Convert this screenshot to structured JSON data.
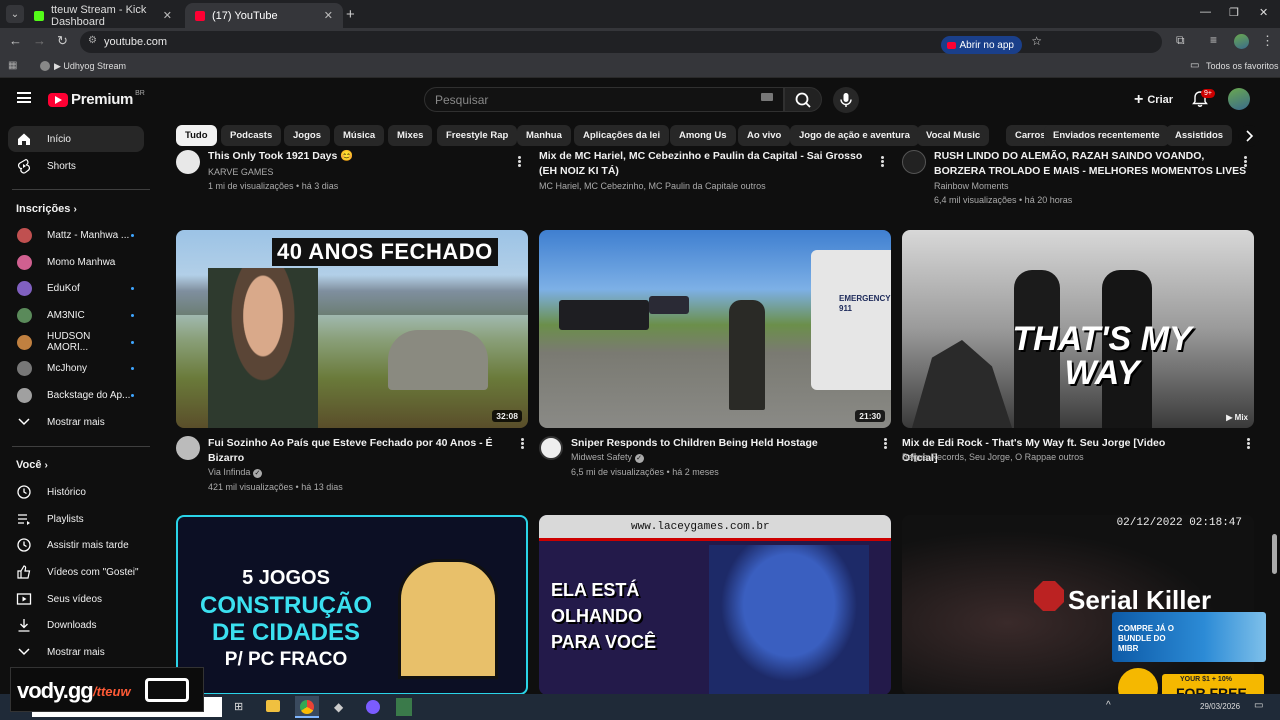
{
  "browser": {
    "tabs": [
      {
        "label": "tteuw Stream - Kick Dashboard",
        "favicon_color": "#53fc18"
      },
      {
        "label": "(17) YouTube",
        "favicon_color": "#ff0033"
      }
    ],
    "url": "youtube.com",
    "open_app_label": "Abrir no app",
    "bookmark": "Udhyog Stream",
    "all_favorites": "Todos os favoritos"
  },
  "header": {
    "logo_text": "Premium",
    "region": "BR",
    "search_placeholder": "Pesquisar",
    "create_label": "Criar",
    "notifications_badge": "9+"
  },
  "sidebar": {
    "main": [
      {
        "label": "Início",
        "icon": "home-icon",
        "active": true
      },
      {
        "label": "Shorts",
        "icon": "shorts-icon",
        "active": false
      }
    ],
    "subscriptions_title": "Inscrições",
    "subscriptions": [
      {
        "label": "Mattz - Manhwa ...",
        "color": "#c05050"
      },
      {
        "label": "Momo Manhwa",
        "color": "#d06090"
      },
      {
        "label": "EduKof",
        "color": "#8060c0"
      },
      {
        "label": "AM3NIC",
        "color": "#5a8a5a"
      },
      {
        "label": "HUDSON AMORI...",
        "color": "#c08040"
      },
      {
        "label": "McJhony",
        "color": "#777777"
      },
      {
        "label": "Backstage do Ap...",
        "color": "#a0a0a0"
      }
    ],
    "show_more": "Mostrar mais",
    "you_title": "Você",
    "you_items": [
      {
        "label": "Histórico",
        "icon": "history-icon"
      },
      {
        "label": "Playlists",
        "icon": "playlists-icon"
      },
      {
        "label": "Assistir mais tarde",
        "icon": "watch-later-icon"
      },
      {
        "label": "Vídeos com \"Gostei\"",
        "icon": "thumbs-up-icon"
      },
      {
        "label": "Seus vídeos",
        "icon": "your-videos-icon"
      },
      {
        "label": "Downloads",
        "icon": "download-icon"
      }
    ],
    "show_more_2": "Mostrar mais"
  },
  "chips": [
    "Tudo",
    "Podcasts",
    "Jogos",
    "Música",
    "Mixes",
    "Freestyle Rap",
    "Manhua",
    "Aplicações da lei",
    "Among Us",
    "Ao vivo",
    "Jogo de ação e aventura",
    "Vocal Music",
    "Carros",
    "Enviados recentemente",
    "Assistidos"
  ],
  "top_row": [
    {
      "title": "This Only Took 1921 Days 😊",
      "channel": "KARVE GAMES",
      "stats": "1 mi de visualizações • há 3 dias"
    },
    {
      "title": "Mix de MC Hariel, MC Cebezinho e Paulin da Capital - Sai Grosso (EH NOIZ KI TÁ)",
      "channel": "MC Hariel, MC Cebezinho, MC Paulin da Capitale outros",
      "stats": ""
    },
    {
      "title": "RUSH LINDO DO ALEMÃO, RAZAH SAINDO VOANDO, BORZERA TROLADO E MAIS - MELHORES MOMENTOS LIVES R6",
      "channel": "Rainbow Moments",
      "stats": "6,4 mil visualizações • há 20 horas"
    }
  ],
  "videos": [
    {
      "title": "Fui Sozinho Ao País que Esteve Fechado por 40 Anos - É Bizarro",
      "channel": "Via Infinda",
      "verified": true,
      "stats": "421 mil visualizações • há 13 dias",
      "duration": "32:08",
      "overlay": "40 ANOS FECHADO"
    },
    {
      "title": "Sniper Responds to Children Being Held Hostage",
      "channel": "Midwest Safety",
      "verified": true,
      "stats": "6,5 mi de visualizações • há 2 meses",
      "duration": "21:30",
      "overlay": "EMERGENCY 911"
    },
    {
      "title": "Mix de Edi Rock - That's My Way ft. Seu Jorge [Video Oficial]",
      "channel": "Bagua Records, Seu Jorge, O Rappae outros",
      "verified": false,
      "stats": "",
      "duration": "Mix",
      "overlay": "THAT'S MY WAY"
    }
  ],
  "bottom_thumbs": [
    {
      "overlay_line1": "5 JOGOS",
      "overlay_line2": "CONSTRUÇÃO",
      "overlay_line3": "DE CIDADES",
      "overlay_line4": "P/ PC FRACO"
    },
    {
      "url_bar": "www.laceygames.com.br",
      "overlay_line1": "ELA ESTÁ",
      "overlay_line2": "OLHANDO",
      "overlay_line3": "PARA VOCÊ"
    },
    {
      "timestamp": "02/12/2022 02:18:47",
      "overlay": "Serial Killer"
    }
  ],
  "overlays": {
    "vody_brand": "vody.gg",
    "vody_user": "/tteuw",
    "ad_text": "COMPRE JÁ O BUNDLE DO MIBR",
    "ad2_text": "FOR FREE",
    "ad2_small": "YOUR $1 + 10%",
    "clock_date": "29/03/2026"
  }
}
